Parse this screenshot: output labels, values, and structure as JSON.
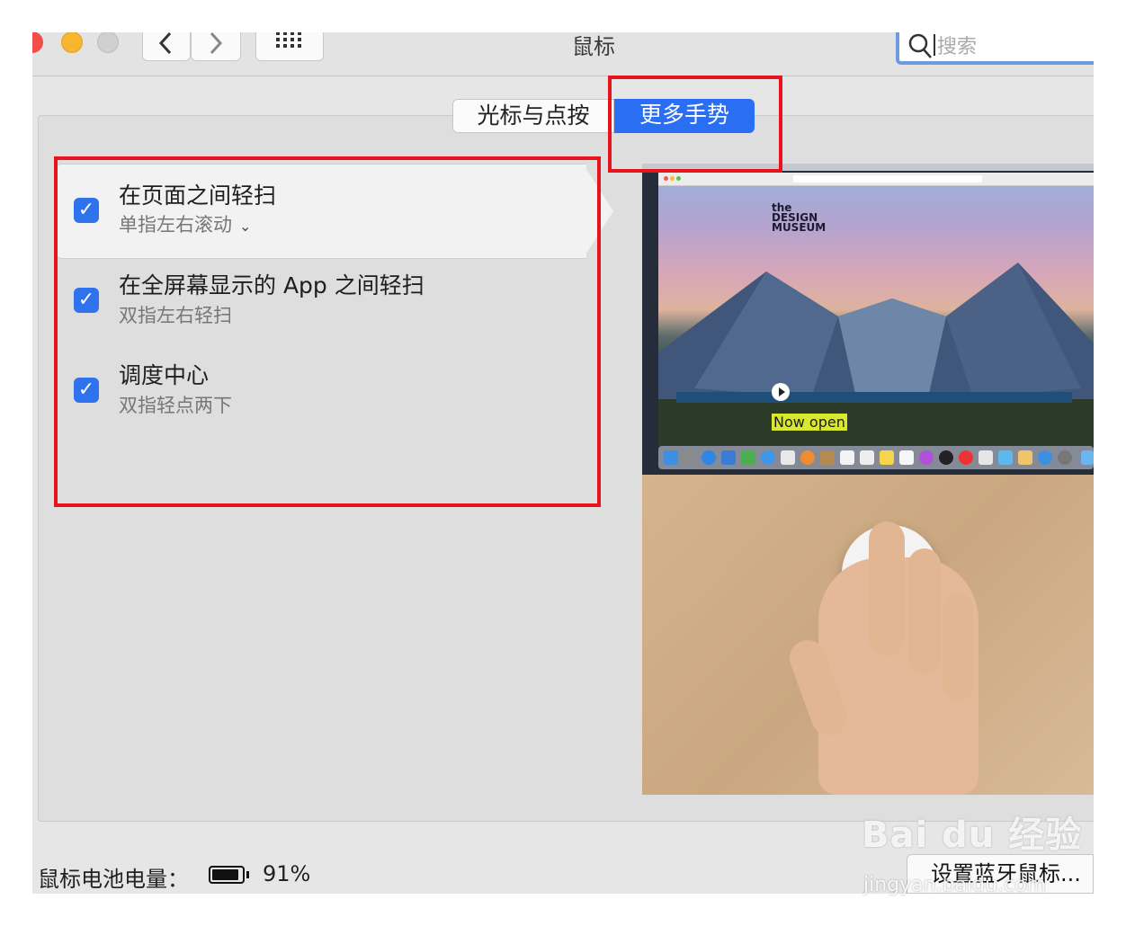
{
  "window": {
    "title": "鼠标",
    "search_placeholder": "搜索",
    "nav": {
      "back": "‹",
      "forward": "›",
      "grid": "⠿"
    }
  },
  "tabs": [
    {
      "label": "光标与点按",
      "selected": false
    },
    {
      "label": "更多手势",
      "selected": true
    }
  ],
  "gestures": [
    {
      "title": "在页面之间轻扫",
      "subtitle": "单指左右滚动",
      "checked": true,
      "has_dropdown": true
    },
    {
      "title": "在全屏幕显示的 App 之间轻扫",
      "subtitle": "双指左右轻扫",
      "checked": true,
      "has_dropdown": false
    },
    {
      "title": "调度中心",
      "subtitle": "双指轻点两下",
      "checked": true,
      "has_dropdown": false
    }
  ],
  "preview": {
    "site_logo": [
      "the",
      "DESIGN",
      "MUSEUM"
    ],
    "banner_text": "Now open"
  },
  "footer": {
    "battery_label": "鼠标电池电量：",
    "battery_percent": "91%",
    "battery_level": 0.91,
    "bluetooth_button": "设置蓝牙鼠标..."
  },
  "watermark": {
    "text": "Bai du 经验",
    "sub": "jingyan.baidu.com"
  },
  "colors": {
    "accent": "#2a6ef3",
    "highlight": "#e8131b"
  }
}
